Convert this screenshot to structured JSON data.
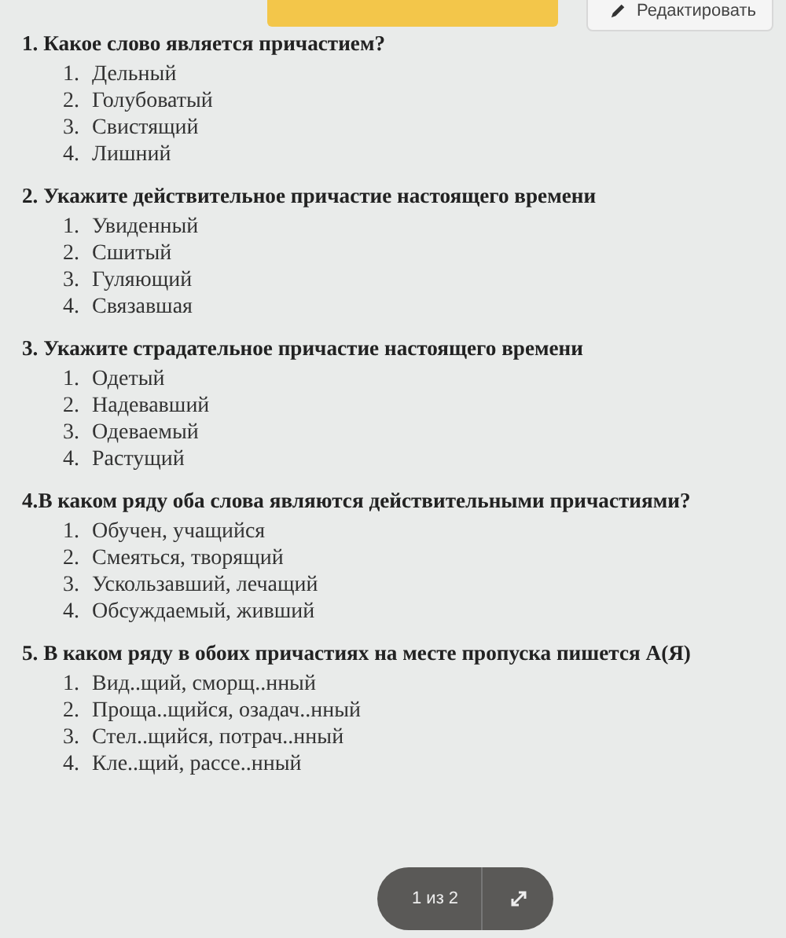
{
  "toolbar": {
    "edit_button": "Редактировать"
  },
  "questions": [
    {
      "title": "1. Какое слово является причастием?",
      "options": [
        {
          "num": "1.",
          "text": "Дельный"
        },
        {
          "num": "2.",
          "text": "Голубоватый"
        },
        {
          "num": "3.",
          "text": "Свистящий"
        },
        {
          "num": "4.",
          "text": "Лишний"
        }
      ]
    },
    {
      "title": "2. Укажите действительное причастие настоящего времени",
      "options": [
        {
          "num": "1.",
          "text": "Увиденный"
        },
        {
          "num": "2.",
          "text": "Сшитый"
        },
        {
          "num": "3.",
          "text": "Гуляющий"
        },
        {
          "num": "4.",
          "text": "Связавшая"
        }
      ]
    },
    {
      "title": "3. Укажите страдательное причастие настоящего времени",
      "options": [
        {
          "num": "1.",
          "text": "Одетый"
        },
        {
          "num": "2.",
          "text": "Надевавший"
        },
        {
          "num": "3.",
          "text": "Одеваемый"
        },
        {
          "num": "4.",
          "text": "Растущий"
        }
      ]
    },
    {
      "title": "4.В каком ряду оба слова являются действительными причастиями?",
      "options": [
        {
          "num": "1.",
          "text": "Обучен, учащийся"
        },
        {
          "num": "2.",
          "text": "Смеяться, творящий"
        },
        {
          "num": "3.",
          "text": "Ускользавший, лечащий"
        },
        {
          "num": "4.",
          "text": "Обсуждаемый, живший"
        }
      ]
    },
    {
      "title": "5. В каком ряду в обоих причастиях на месте пропуска пишется А(Я)",
      "options": [
        {
          "num": "1.",
          "text": "Вид..щий, сморщ..нный"
        },
        {
          "num": "2.",
          "text": "Проща..щийся, озадач..нный"
        },
        {
          "num": "3.",
          "text": "Стел..щийся, потрач..нный"
        },
        {
          "num": "4.",
          "text": "Кле..щий, рассе..нный"
        }
      ]
    }
  ],
  "pager": {
    "label": "1 из 2"
  }
}
